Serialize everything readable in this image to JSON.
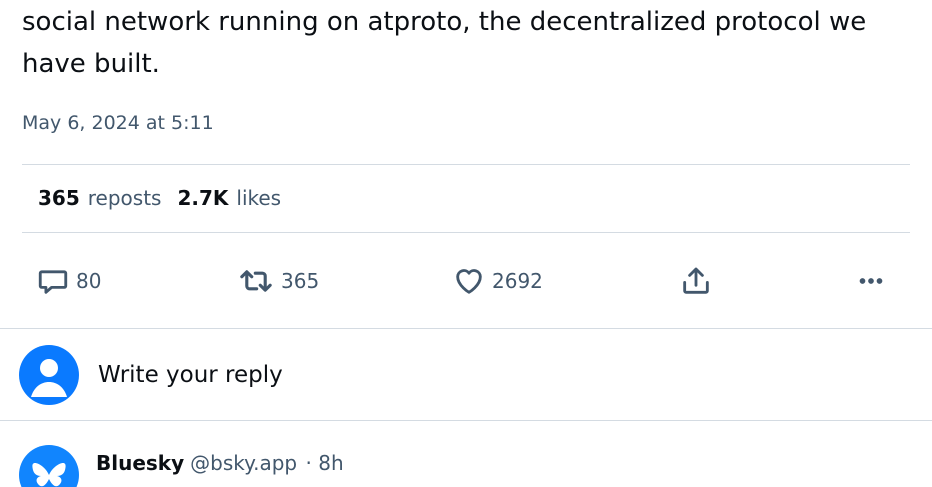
{
  "post": {
    "text": "social network running on atproto, the decentralized protocol we have built.",
    "timestamp": "May 6, 2024 at 5:11"
  },
  "stats": {
    "reposts_count": "365",
    "reposts_label": "reposts",
    "likes_count": "2.7K",
    "likes_label": "likes"
  },
  "actions": {
    "reply_count": "80",
    "repost_count": "365",
    "like_count": "2692",
    "share_icon": "share-icon",
    "more_icon": "more-icon"
  },
  "reply_box": {
    "placeholder": "Write your reply"
  },
  "next_post": {
    "author_name": "Bluesky",
    "author_handle": "@bsky.app",
    "separator": "·",
    "age": "8h"
  },
  "colors": {
    "text": "#0b0f14",
    "muted": "#42576c",
    "divider": "#d4dbe2",
    "avatar_blue": "#0a7aff",
    "bluesky_blue": "#1185fe"
  }
}
